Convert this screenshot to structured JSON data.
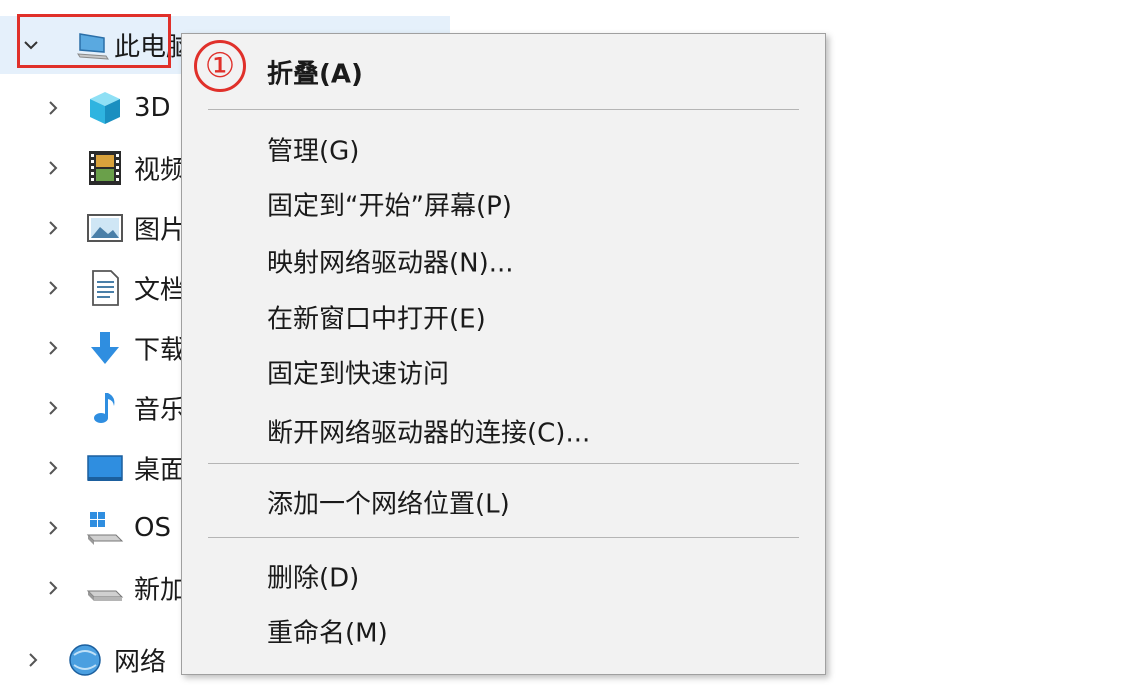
{
  "tree": {
    "root": {
      "label": "此电脑",
      "icon": "computer-icon",
      "expanded": true
    },
    "items": [
      {
        "label": "3D",
        "icon": "3d-objects-icon"
      },
      {
        "label": "视频",
        "icon": "video-icon"
      },
      {
        "label": "图片",
        "icon": "picture-icon"
      },
      {
        "label": "文档",
        "icon": "document-icon"
      },
      {
        "label": "下载",
        "icon": "download-icon"
      },
      {
        "label": "音乐",
        "icon": "music-icon"
      },
      {
        "label": "桌面",
        "icon": "desktop-icon"
      },
      {
        "label": "OS",
        "icon": "windows-drive-icon"
      },
      {
        "label": "新加",
        "icon": "drive-icon"
      },
      {
        "label": "网络",
        "icon": "network-icon"
      }
    ]
  },
  "annotation": {
    "step": "①",
    "color": "#e0302a"
  },
  "menu": {
    "items": [
      {
        "label": "折叠(A)",
        "bold": true
      },
      {
        "label": "管理(G)"
      },
      {
        "label": "固定到“开始”屏幕(P)"
      },
      {
        "label": "映射网络驱动器(N)..."
      },
      {
        "label": "在新窗口中打开(E)"
      },
      {
        "label": "固定到快速访问"
      },
      {
        "label": "断开网络驱动器的连接(C)..."
      },
      {
        "label": "添加一个网络位置(L)"
      },
      {
        "label": "删除(D)"
      },
      {
        "label": "重命名(M)"
      }
    ]
  }
}
